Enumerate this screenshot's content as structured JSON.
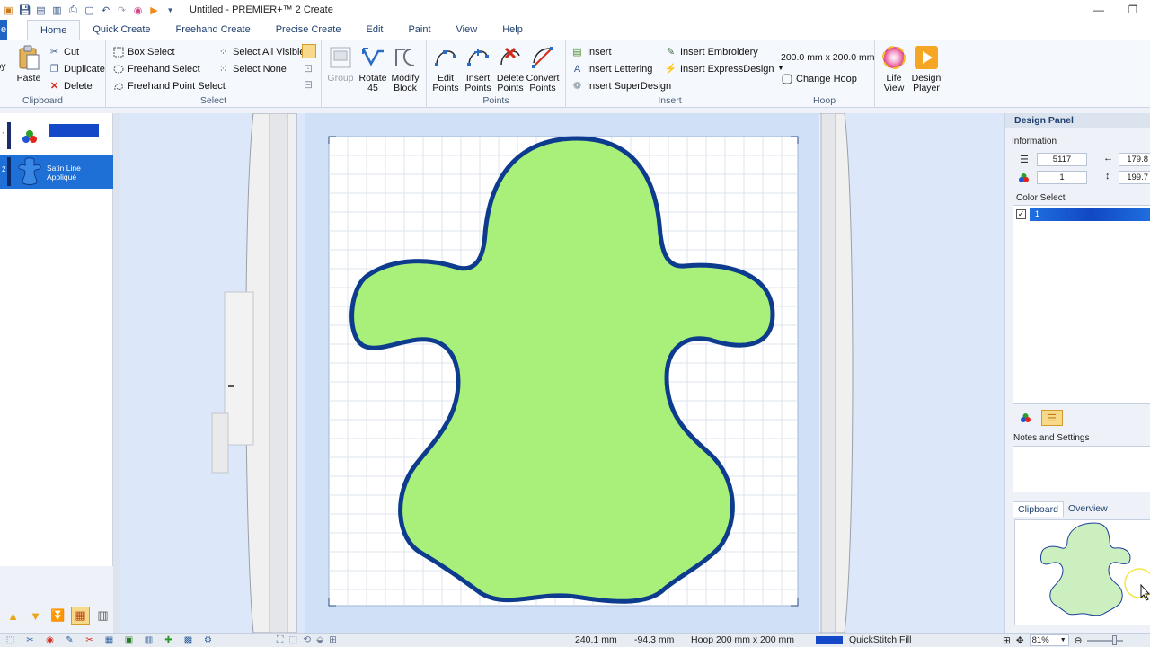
{
  "window": {
    "title": "Untitled - PREMIER+™ 2 Create",
    "minimize_glyph": "—",
    "restore_glyph": "❐"
  },
  "quick_access": [
    "app-icon",
    "save-icon",
    "save-as-icon",
    "save-all-icon",
    "print-icon",
    "new-icon",
    "undo-icon",
    "redo-icon",
    "life-view-icon",
    "play-icon",
    "dropdown-icon"
  ],
  "tabs": [
    {
      "label": "e",
      "name": "tab-file"
    },
    {
      "label": "Home",
      "name": "tab-home",
      "active": true
    },
    {
      "label": "Quick Create",
      "name": "tab-quick-create"
    },
    {
      "label": "Freehand Create",
      "name": "tab-freehand-create"
    },
    {
      "label": "Precise Create",
      "name": "tab-precise-create"
    },
    {
      "label": "Edit",
      "name": "tab-edit"
    },
    {
      "label": "Paint",
      "name": "tab-paint"
    },
    {
      "label": "View",
      "name": "tab-view"
    },
    {
      "label": "Help",
      "name": "tab-help"
    }
  ],
  "ribbon": {
    "clipboard": {
      "label": "Clipboard",
      "copy_label": "py",
      "paste_label": "Paste",
      "cut_label": "Cut",
      "duplicate_label": "Duplicate",
      "delete_label": "Delete"
    },
    "select": {
      "label": "Select",
      "box_select": "Box Select",
      "freehand_select": "Freehand Select",
      "freehand_point_select": "Freehand Point Select",
      "select_all_visible": "Select All Visible",
      "select_none": "Select None",
      "group": "Group",
      "rotate": "Rotate 45",
      "modify_block": "Modify Block"
    },
    "points": {
      "label": "Points",
      "edit": "Edit Points",
      "insert": "Insert Points",
      "delete": "Delete Points",
      "convert": "Convert Points"
    },
    "insert": {
      "label": "Insert",
      "insert": "Insert",
      "insert_lettering": "Insert Lettering",
      "insert_superdesign": "Insert SuperDesign",
      "insert_embroidery": "Insert Embroidery",
      "insert_expressdesign": "Insert ExpressDesign"
    },
    "hoop": {
      "label": "Hoop",
      "size": "200.0 mm x 200.0 mm",
      "change_hoop": "Change Hoop"
    },
    "view": {
      "life_view": "Life View",
      "design_player": "Design Player"
    }
  },
  "layers": [
    {
      "number": "1",
      "label": ""
    },
    {
      "number": "2",
      "label": "Satin Line Appliqué"
    }
  ],
  "design_panel": {
    "title": "Design Panel",
    "information_label": "Information",
    "stitches": "5117",
    "colors": "1",
    "width": "179.8",
    "height": "199.7",
    "color_select_label": "Color Select",
    "color_item": "1",
    "notes_label": "Notes and Settings",
    "clipboard_tab": "Clipboard",
    "overview_tab": "Overview"
  },
  "status": {
    "x": "240.1 mm",
    "y": "-94.3 mm",
    "hoop": "Hoop 200 mm x 200 mm",
    "fill": "QuickStitch Fill",
    "zoom": "81%"
  },
  "colors": {
    "accent": "#1f65c4",
    "fill_green": "#a8f07a",
    "outline_blue": "#0d3b8e",
    "selected_layer": "#1f70d6",
    "canvas_bg": "#dce8fa"
  }
}
